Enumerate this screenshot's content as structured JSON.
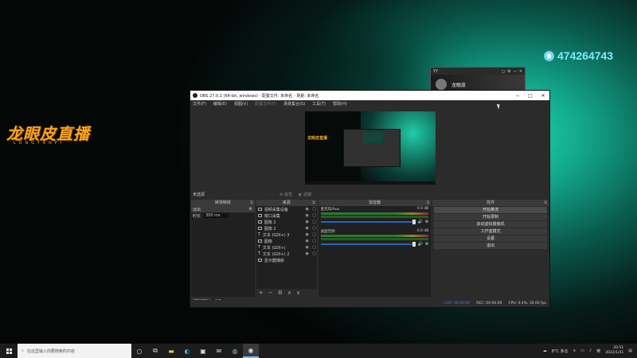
{
  "desktop": {
    "logo": "龙眼皮直播",
    "logo_sub": "LONGYANPI",
    "qq_number": "474264743"
  },
  "popup": {
    "title": "YY",
    "user": "龙眼皮"
  },
  "obs": {
    "title": "OBS 27.0.1 (64-bit, windows) - 配置文件: 未命名 - 场景: 未命名",
    "menu": [
      "文件(F)",
      "编辑(E)",
      "视图(V)",
      "配置文件(P)",
      "场景集合(S)",
      "工具(T)",
      "帮助(H)"
    ],
    "no_source": "未选源",
    "props": "属性",
    "filters": "滤镜",
    "preview_logo": "龙眼皮直播",
    "transitions": {
      "header": "转场特效",
      "items": [
        "淡出",
        "时长"
      ],
      "duration": "300 ms"
    },
    "sources": {
      "header": "来源",
      "items": [
        "视频采集设备",
        "窗口采集",
        "图像 2",
        "图像 2",
        "文本 (GDI+) 3",
        "图像",
        "文本 (GDI+)",
        "文本 (GDI+) 2",
        "显示器捕获"
      ]
    },
    "mixer": {
      "header": "混音器",
      "tracks": [
        {
          "name": "麦克风/Aux",
          "db": "0.0 dB"
        },
        {
          "name": "桌面音频",
          "db": "0.0 dB"
        }
      ]
    },
    "controls": {
      "header": "控件",
      "items": [
        "开始推流",
        "开始录制",
        "启动虚拟摄像机",
        "工作室模式",
        "设置",
        "退出"
      ]
    },
    "bottom_tabs": [
      "转场特效",
      "场景"
    ],
    "status": {
      "live": "LIVE: 00:00:00",
      "rec": "REC: 00:00:00",
      "cpu": "CPU: 0.4%, 30.00 fps"
    }
  },
  "taskbar": {
    "search_placeholder": "在这里输入你要搜索的内容",
    "weather": "8°C 多云",
    "time": "20:51",
    "date": "2022/1/31",
    "lang": "英"
  }
}
